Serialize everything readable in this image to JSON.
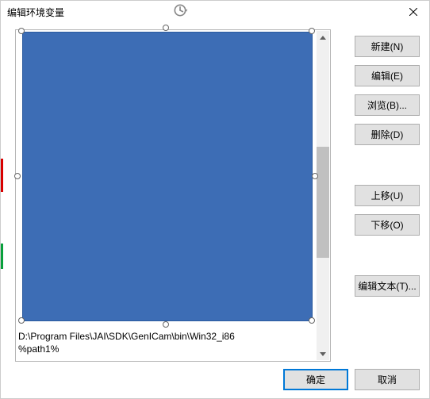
{
  "title": "编辑环境变量",
  "buttons": {
    "new": "新建(N)",
    "edit": "编辑(E)",
    "browse": "浏览(B)...",
    "delete": "删除(D)",
    "moveup": "上移(U)",
    "movedown": "下移(O)",
    "edittext": "编辑文本(T)...",
    "ok": "确定",
    "cancel": "取消"
  },
  "list": {
    "line1": "D:\\Program Files\\JAI\\SDK\\GenICam\\bin\\Win32_i86",
    "line2": "%path1%"
  }
}
